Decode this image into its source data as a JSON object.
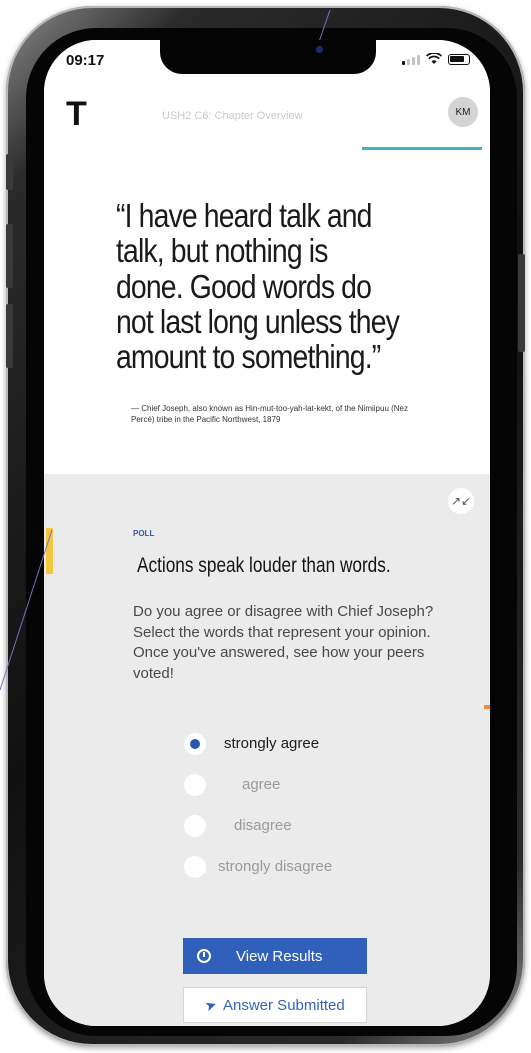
{
  "status_bar": {
    "time": "09:17"
  },
  "header": {
    "brand_letter": "T",
    "title": "USH2 C6: Chapter Overview",
    "avatar_initials": "KM"
  },
  "quote": {
    "text": "“I have heard talk and talk, but nothing is done. Good words do not last long unless they amount to something.”",
    "attribution": "— Chief Joseph, also known as Hin-mut-too-yah-lat-kekt, of the Nimiipuu (Nez Percé) tribe in the Pacific Northwest, 1879"
  },
  "poll": {
    "label": "POLL",
    "heading": "Actions speak louder than words.",
    "description": "Do you agree or disagree with Chief Joseph? Select the words that represent your opinion.  Once you've answered, see how your peers voted!",
    "options": [
      {
        "label": "strongly agree",
        "selected": true
      },
      {
        "label": "agree",
        "selected": false
      },
      {
        "label": "disagree",
        "selected": false
      },
      {
        "label": "strongly disagree",
        "selected": false
      }
    ],
    "view_results_label": "View Results",
    "answer_submitted_label": "Answer Submitted"
  },
  "icons": {
    "collapse": "collapse-icon",
    "results": "clock-icon",
    "submitted": "send-icon"
  },
  "colors": {
    "accent_blue": "#3060b9",
    "progress_teal": "#3fb3c5",
    "accent_yellow": "#f3c63f",
    "accent_orange": "#ee8a3a"
  }
}
